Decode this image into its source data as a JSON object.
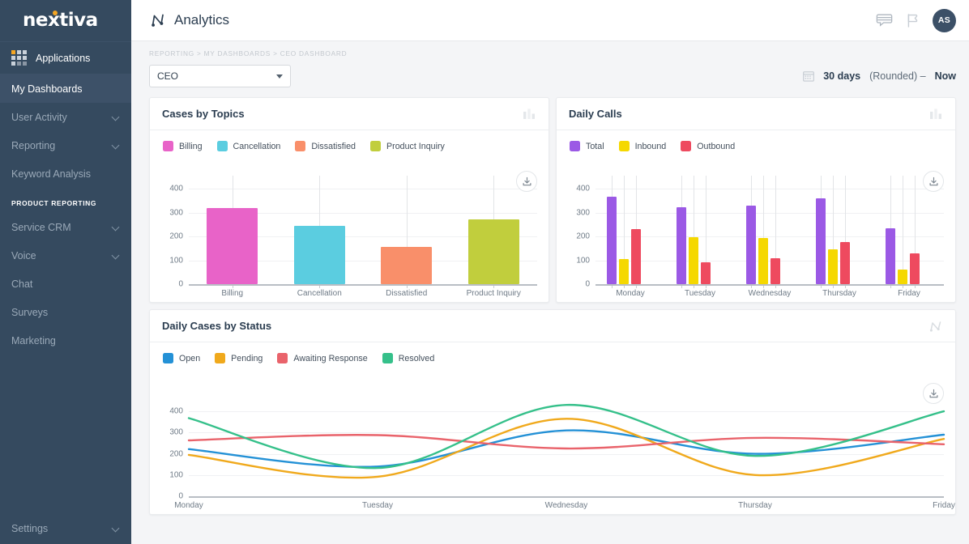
{
  "sidebar": {
    "logo": "nextiva",
    "applications_label": "Applications",
    "items": [
      {
        "label": "My Dashboards",
        "active": true,
        "chevron": false
      },
      {
        "label": "User Activity",
        "active": false,
        "chevron": true
      },
      {
        "label": "Reporting",
        "active": false,
        "chevron": true
      },
      {
        "label": "Keyword Analysis",
        "active": false,
        "chevron": false
      }
    ],
    "section_title": "PRODUCT REPORTING",
    "product_items": [
      {
        "label": "Service CRM",
        "chevron": true
      },
      {
        "label": "Voice",
        "chevron": true
      },
      {
        "label": "Chat",
        "chevron": false
      },
      {
        "label": "Surveys",
        "chevron": false
      },
      {
        "label": "Marketing",
        "chevron": false
      }
    ],
    "bottom_items": [
      {
        "label": "Settings",
        "chevron": true
      }
    ]
  },
  "topbar": {
    "title": "Analytics",
    "icons": [
      "chat-bubble-icon",
      "flag-icon"
    ],
    "avatar_initials": "AS"
  },
  "subbar": {
    "breadcrumb": "REPORTING  >  MY DASHBOARDS  >  CEO DASHBOARD",
    "dashboard_select_value": "CEO",
    "date_range": {
      "strong": "30 days",
      "soft": "(Rounded)  –",
      "now": "Now"
    }
  },
  "colors": {
    "sidebar_bg": "#354a5f",
    "accent_yellow": "#f5a623",
    "card_bg": "#ffffff",
    "page_bg": "#f4f5f7"
  },
  "cards": [
    {
      "title": "Cases by Topics",
      "type_icon": "bar-chart-icon",
      "download_icon": "download-icon"
    },
    {
      "title": "Daily Calls",
      "type_icon": "bar-chart-icon",
      "download_icon": "download-icon"
    },
    {
      "title": "Daily Cases by Status",
      "type_icon": "line-chart-icon",
      "download_icon": "download-icon"
    }
  ],
  "chart_data": [
    {
      "type": "bar",
      "title": "Cases by Topics",
      "categories": [
        "Billing",
        "Cancellation",
        "Dissatisfied",
        "Product Inquiry"
      ],
      "values": [
        320,
        243,
        157,
        273
      ],
      "colors": [
        "#e863c8",
        "#5bcde0",
        "#f98f6a",
        "#c1ce3d"
      ],
      "legend": [
        "Billing",
        "Cancellation",
        "Dissatisfied",
        "Product Inquiry"
      ],
      "legend_position": "top-left",
      "xlabel": "",
      "ylabel": "",
      "yticks": [
        0,
        100,
        200,
        300,
        400
      ],
      "ylim": [
        0,
        400
      ],
      "grid": true
    },
    {
      "type": "bar",
      "title": "Daily Calls",
      "categories": [
        "Monday",
        "Tuesday",
        "Wednesday",
        "Thursday",
        "Friday"
      ],
      "series": [
        {
          "name": "Total",
          "color": "#9b59e5",
          "values": [
            365,
            322,
            330,
            358,
            235
          ]
        },
        {
          "name": "Inbound",
          "color": "#f5d800",
          "values": [
            105,
            198,
            193,
            145,
            62
          ]
        },
        {
          "name": "Outbound",
          "color": "#ee4a5f",
          "values": [
            232,
            92,
            110,
            177,
            128
          ]
        }
      ],
      "legend": [
        "Total",
        "Inbound",
        "Outbound"
      ],
      "legend_position": "top-left",
      "xlabel": "",
      "ylabel": "",
      "yticks": [
        0,
        100,
        200,
        300,
        400
      ],
      "ylim": [
        0,
        400
      ],
      "grid": true
    },
    {
      "type": "line",
      "title": "Daily Cases by Status",
      "categories": [
        "Monday",
        "Tuesday",
        "Wednesday",
        "Thursday",
        "Friday"
      ],
      "x": [
        0,
        1,
        2,
        3,
        4
      ],
      "series": [
        {
          "name": "Open",
          "color": "#2491d6",
          "values": [
            222,
            140,
            310,
            200,
            290
          ]
        },
        {
          "name": "Pending",
          "color": "#f0a91c",
          "values": [
            195,
            92,
            365,
            100,
            270
          ]
        },
        {
          "name": "Awaiting Response",
          "color": "#e9636b",
          "values": [
            263,
            288,
            225,
            275,
            245
          ]
        },
        {
          "name": "Resolved",
          "color": "#35c08a",
          "values": [
            368,
            133,
            430,
            190,
            400
          ]
        }
      ],
      "legend": [
        "Open",
        "Pending",
        "Awaiting Response",
        "Resolved"
      ],
      "legend_position": "top-left",
      "xlabel": "",
      "ylabel": "",
      "yticks": [
        0,
        100,
        200,
        300,
        400
      ],
      "ylim": [
        0,
        450
      ],
      "grid": true,
      "smoothing": "spline"
    }
  ]
}
